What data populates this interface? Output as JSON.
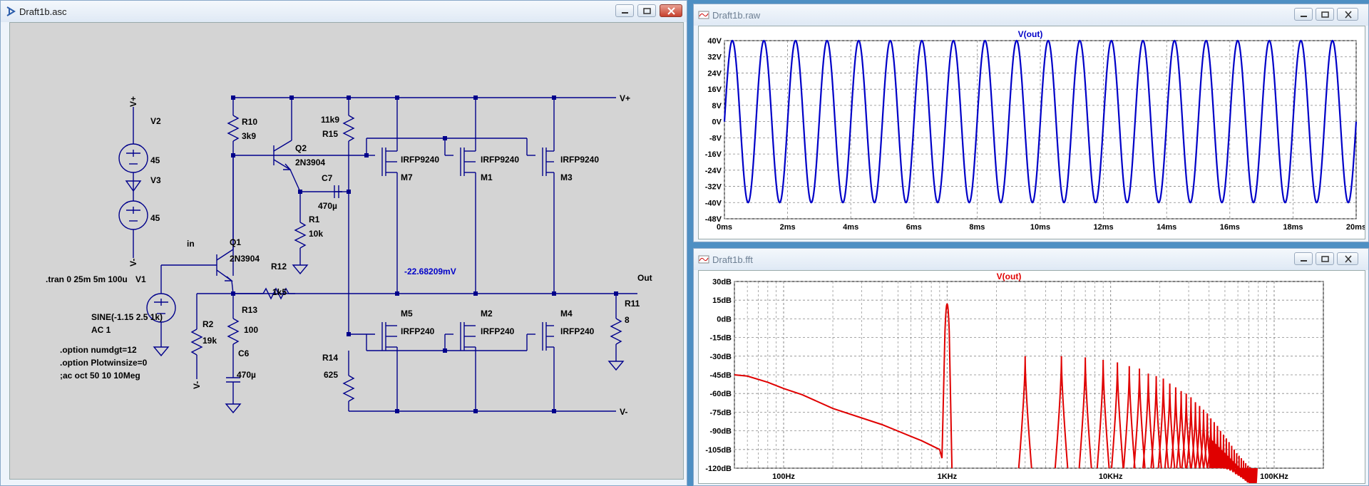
{
  "schematic": {
    "title": "Draft1b.asc",
    "labels": {
      "vplus_src": "V+",
      "v2": "V2",
      "v2_val": "45",
      "v3": "V3",
      "v3_val": "45",
      "vminus_src": "V-",
      "r10": "R10",
      "r10_val": "3k9",
      "q2": "Q2",
      "q2_model": "2N3904",
      "r15_val": "11k9",
      "r15": "R15",
      "c7": "C7",
      "c7_val": "470µ",
      "r1": "R1",
      "r1_val": "10k",
      "in": "in",
      "q1": "Q1",
      "q1_model": "2N3904",
      "r12": "R12",
      "r12_val": "1k5",
      "tran": ".tran 0 25m 5m 100u",
      "v1": "V1",
      "sine": "SINE(-1.15 2.5 1k)",
      "ac": "AC 1",
      "r2": "R2",
      "r2_val": "19k",
      "r13": "R13",
      "r13_val": "100",
      "c6": "C6",
      "c6_val": "470µ",
      "opt1": ".option numdgt=12",
      "opt2": ".option Plotwinsize=0",
      "opt3": ";ac oct 50 10 10Meg",
      "m7_model": "IRFP9240",
      "m7": "M7",
      "m1_model": "IRFP9240",
      "m1": "M1",
      "m3_model": "IRFP9240",
      "m3": "M3",
      "m5": "M5",
      "m5_model": "IRFP240",
      "m2": "M2",
      "m2_model": "IRFP240",
      "m4": "M4",
      "m4_model": "IRFP240",
      "node_voltage": "-22.68209mV",
      "out": "Out",
      "r11": "R11",
      "r11_val": "8",
      "r14": "R14",
      "r14_val": "625",
      "vplus_rail": "V+",
      "vminus_rail": "V-",
      "vminus_r2": "V-"
    }
  },
  "raw": {
    "title": "Draft1b.raw",
    "trace_label": "V(out)",
    "trace_color": "#0000c8",
    "y_ticks": [
      "40V",
      "32V",
      "24V",
      "16V",
      "8V",
      "0V",
      "-8V",
      "-16V",
      "-24V",
      "-32V",
      "-40V",
      "-48V"
    ],
    "x_ticks": [
      "0ms",
      "2ms",
      "4ms",
      "6ms",
      "8ms",
      "10ms",
      "12ms",
      "14ms",
      "16ms",
      "18ms",
      "20ms"
    ]
  },
  "fft": {
    "title": "Draft1b.fft",
    "trace_label": "V(out)",
    "trace_color": "#e00000",
    "y_ticks": [
      "30dB",
      "15dB",
      "0dB",
      "-15dB",
      "-30dB",
      "-45dB",
      "-60dB",
      "-75dB",
      "-90dB",
      "-105dB",
      "-120dB"
    ],
    "x_ticks": [
      "100Hz",
      "1KHz",
      "10KHz",
      "100KHz"
    ]
  },
  "chart_data": [
    {
      "type": "line",
      "title": "V(out)",
      "xlabel": "",
      "ylabel": "",
      "xlim": [
        0,
        20
      ],
      "ylim": [
        -48,
        40
      ],
      "x_unit": "ms",
      "y_unit": "V",
      "series": [
        {
          "name": "V(out)",
          "waveform": "sine",
          "frequency_khz": 1,
          "amplitude": 40,
          "offset": 0,
          "x": [
            0,
            20
          ]
        }
      ]
    },
    {
      "type": "line",
      "title": "V(out)",
      "xlabel": "",
      "ylabel": "",
      "x_scale": "log",
      "xlim": [
        50,
        200000
      ],
      "ylim": [
        -120,
        30
      ],
      "x_unit": "Hz",
      "y_unit": "dB",
      "series": [
        {
          "name": "V(out)",
          "fundamental": {
            "freq": 1000,
            "peak_db": 28
          },
          "noise_floor": {
            "x": [
              50,
              60,
              80,
              100,
              130,
              200,
              400,
              700,
              900
            ],
            "y": [
              -45,
              -46,
              -51,
              -56,
              -61,
              -72,
              -85,
              -98,
              -105
            ]
          },
          "harmonics_db": [
            -30,
            -30,
            -31,
            -33,
            -35,
            -38,
            -40,
            -44,
            -46,
            -48,
            -52,
            -55,
            -58,
            -60,
            -63,
            -67,
            -70,
            -73,
            -76,
            -80,
            -83,
            -86,
            -90,
            -93,
            -96,
            -99,
            -102,
            -105,
            -108,
            -110,
            -112,
            -114,
            -116,
            -118,
            -119,
            -120,
            -120,
            -120
          ],
          "harmonic_start_freq": 3000
        }
      ]
    }
  ]
}
